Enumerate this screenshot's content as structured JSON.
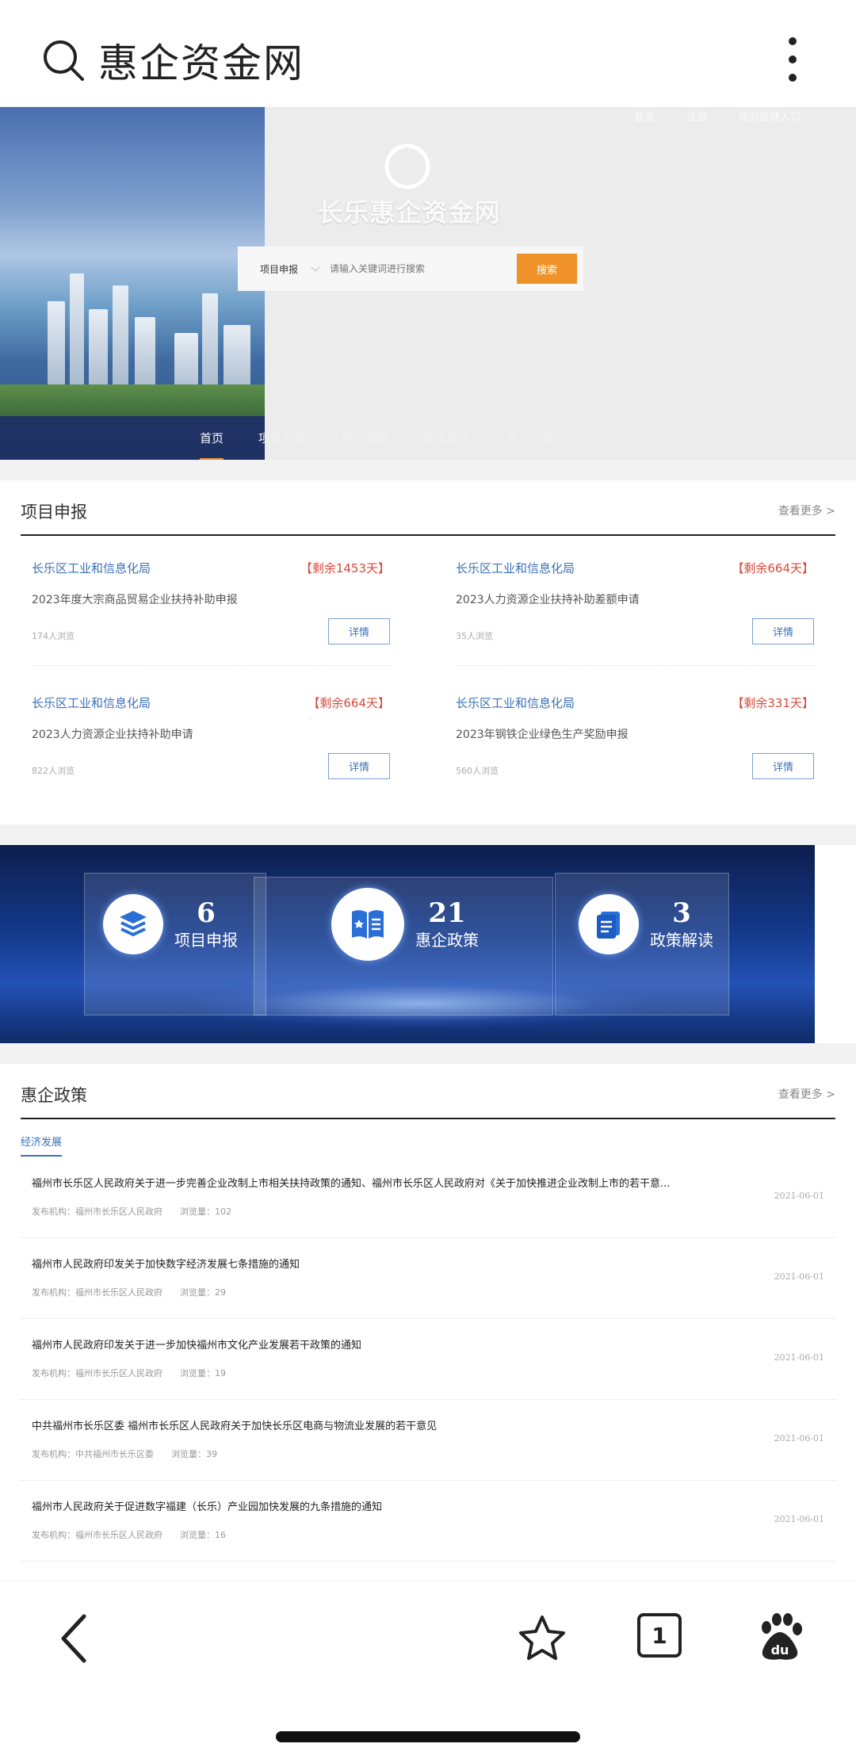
{
  "browser": {
    "title": "惠企资金网",
    "search_icon": "search-icon",
    "menu_icon": "kebab-menu-icon"
  },
  "hero": {
    "toplinks": [
      "登录",
      "注册",
      "政府管理入口"
    ],
    "brand": "长乐惠企资金网",
    "search": {
      "type_label": "项目申报",
      "placeholder": "请输入关键词进行搜索",
      "button": "搜索"
    },
    "nav": [
      "首页",
      "项目申报",
      "惠企政策",
      "政策解读",
      "惠企资金公示"
    ]
  },
  "projects": {
    "heading": "项目申报",
    "more": "查看更多 >",
    "detail_label": "详情",
    "items": [
      {
        "org": "长乐区工业和信息化局",
        "remain": "【剩余1453天】",
        "name": "2023年度大宗商品贸易企业扶持补助申报",
        "views": "174人浏览"
      },
      {
        "org": "长乐区工业和信息化局",
        "remain": "【剩余664天】",
        "name": "2023人力资源企业扶持补助差额申请",
        "views": "35人浏览"
      },
      {
        "org": "长乐区工业和信息化局",
        "remain": "【剩余664天】",
        "name": "2023人力资源企业扶持补助申请",
        "views": "822人浏览"
      },
      {
        "org": "长乐区工业和信息化局",
        "remain": "【剩余331天】",
        "name": "2023年钢铁企业绿色生产奖励申报",
        "views": "560人浏览"
      }
    ]
  },
  "stats": [
    {
      "num": "6",
      "label": "项目申报",
      "icon": "layers-icon"
    },
    {
      "num": "21",
      "label": "惠企政策",
      "icon": "policy-book-icon"
    },
    {
      "num": "3",
      "label": "政策解读",
      "icon": "document-icon"
    }
  ],
  "policies": {
    "heading": "惠企政策",
    "more": "查看更多 >",
    "tab": "经济发展",
    "items": [
      {
        "title": "福州市长乐区人民政府关于进一步完善企业改制上市相关扶持政策的通知、福州市长乐区人民政府对《关于加快推进企业改制上市的若干意...",
        "publisher": "发布机构：福州市长乐区人民政府",
        "views": "浏览量：102",
        "date": "2021-06-01"
      },
      {
        "title": "福州市人民政府印发关于加快数字经济发展七条措施的通知",
        "publisher": "发布机构：福州市长乐区人民政府",
        "views": "浏览量：29",
        "date": "2021-06-01"
      },
      {
        "title": "福州市人民政府印发关于进一步加快福州市文化产业发展若干政策的通知",
        "publisher": "发布机构：福州市长乐区人民政府",
        "views": "浏览量：19",
        "date": "2021-06-01"
      },
      {
        "title": "中共福州市长乐区委 福州市长乐区人民政府关于加快长乐区电商与物流业发展的若干意见",
        "publisher": "发布机构：中共福州市长乐区委",
        "views": "浏览量：39",
        "date": "2021-06-01"
      },
      {
        "title": "福州市人民政府关于促进数字福建（长乐）产业园加快发展的九条措施的通知",
        "publisher": "发布机构：福州市长乐区人民政府",
        "views": "浏览量：16",
        "date": "2021-06-01"
      }
    ]
  },
  "bottom_bar": {
    "tab_count": "1",
    "icons": [
      "back-arrow-icon",
      "star-bookmark-icon",
      "tabs-icon",
      "baidu-paw-icon"
    ]
  }
}
